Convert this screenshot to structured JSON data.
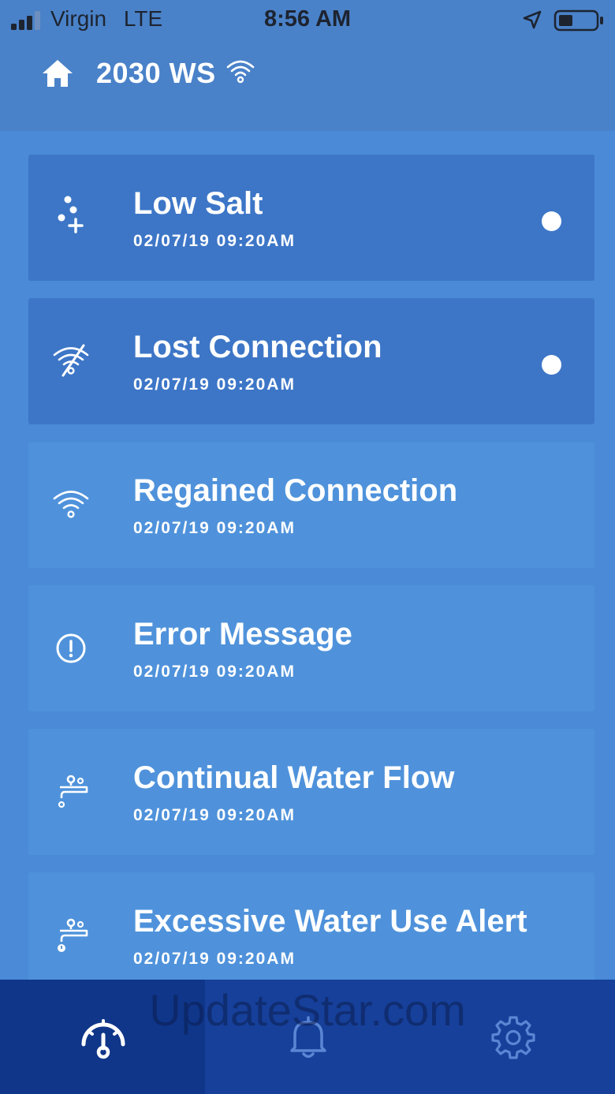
{
  "status_bar": {
    "carrier": "Virgin",
    "network": "LTE",
    "time": "8:56 AM"
  },
  "header": {
    "device_name": "2030 WS",
    "home_icon": "home-icon",
    "wifi_icon": "wifi-icon"
  },
  "alerts": [
    {
      "title": "Low Salt",
      "time": "02/07/19 09:20AM",
      "icon": "salt-icon",
      "unread": true
    },
    {
      "title": "Lost Connection",
      "time": "02/07/19 09:20AM",
      "icon": "wifi-off-icon",
      "unread": true
    },
    {
      "title": "Regained Connection",
      "time": "02/07/19 09:20AM",
      "icon": "wifi-icon",
      "unread": false
    },
    {
      "title": "Error Message",
      "time": "02/07/19 09:20AM",
      "icon": "exclamation-circle-icon",
      "unread": false
    },
    {
      "title": "Continual Water Flow",
      "time": "02/07/19 09:20AM",
      "icon": "faucet-icon",
      "unread": false
    },
    {
      "title": "Excessive Water Use Alert",
      "time": "02/07/19 09:20AM",
      "icon": "faucet-alert-icon",
      "unread": false
    }
  ],
  "tabs": [
    {
      "icon": "dashboard-gauge-icon",
      "active": true
    },
    {
      "icon": "bell-icon",
      "active": false
    },
    {
      "icon": "gear-icon",
      "active": false
    }
  ],
  "watermark": "UpdateStar.com",
  "colors": {
    "background": "#4a8ad6",
    "card_read": "#4f92db",
    "card_unread": "#3d76c7",
    "tabbar": "#16409a",
    "text": "#ffffff"
  }
}
